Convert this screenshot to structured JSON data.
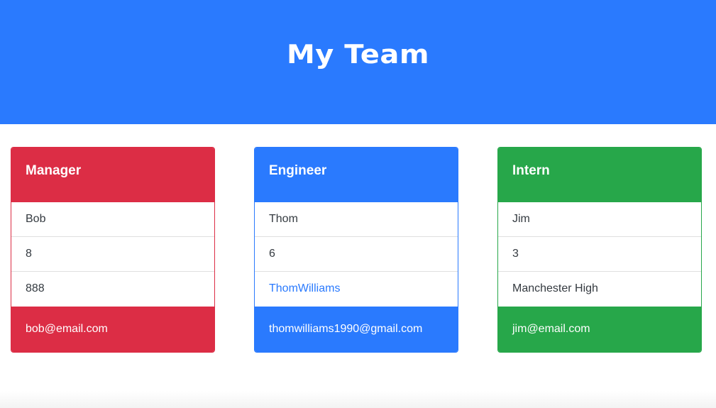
{
  "page": {
    "title": "My Team",
    "header_color": "#2a7afe"
  },
  "cards": [
    {
      "role": "Manager",
      "color": "#dc2d45",
      "name": "Bob",
      "id": "8",
      "extra": "888",
      "email": "bob@email.com"
    },
    {
      "role": "Engineer",
      "color": "#2a7afe",
      "name": "Thom",
      "id": "6",
      "extra": "ThomWilliams",
      "email": "thomwilliams1990@gmail.com"
    },
    {
      "role": "Intern",
      "color": "#27a74a",
      "name": "Jim",
      "id": "3",
      "extra": "Manchester High",
      "email": "jim@email.com"
    }
  ]
}
